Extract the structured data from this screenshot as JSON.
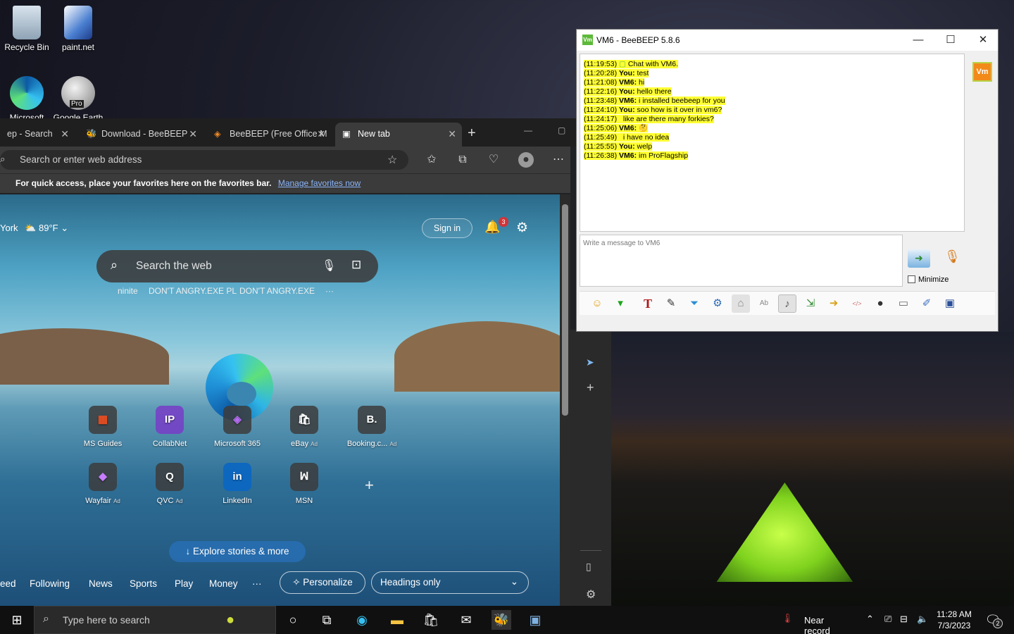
{
  "desktop": {
    "icons": [
      {
        "label": "Recycle Bin"
      },
      {
        "label": "paint.net"
      },
      {
        "label": "Microsoft Edge"
      },
      {
        "label": "Google Earth Pro"
      }
    ],
    "earth_badge": "Pro"
  },
  "edge": {
    "tabs": [
      {
        "label": "ep - Search"
      },
      {
        "label": "Download - BeeBEEP"
      },
      {
        "label": "BeeBEEP (Free Office M"
      },
      {
        "label": "New tab"
      }
    ],
    "address_placeholder": "Search or enter web address",
    "favbar": {
      "text": "For quick access, place your favorites here on the favorites bar.",
      "link": "Manage favorites now"
    },
    "newtab": {
      "location": "York",
      "temp": "89°F",
      "signin": "Sign in",
      "notif_count": "3",
      "search_placeholder": "Search the web",
      "trending": [
        "ninite",
        "DON'T ANGRY.EXE PL",
        "DON'T ANGRY.EXE",
        "···"
      ],
      "quick_links": [
        {
          "label": "MS Guides",
          "ad": "",
          "glyph": "▦"
        },
        {
          "label": "CollabNet",
          "ad": "",
          "glyph": "IP"
        },
        {
          "label": "Microsoft 365",
          "ad": "",
          "glyph": "◈"
        },
        {
          "label": "eBay",
          "ad": "Ad",
          "glyph": "🛍"
        },
        {
          "label": "Booking.c...",
          "ad": "Ad",
          "glyph": "B."
        },
        {
          "label": "Wayfair",
          "ad": "Ad",
          "glyph": "◆"
        },
        {
          "label": "QVC",
          "ad": "Ad",
          "glyph": "Q"
        },
        {
          "label": "LinkedIn",
          "ad": "",
          "glyph": "in"
        },
        {
          "label": "MSN",
          "ad": "",
          "glyph": "ꟽ"
        }
      ],
      "add_link": "+",
      "explore": "Explore stories & more",
      "feed_tabs": [
        "eed",
        "Following",
        "News",
        "Sports",
        "Play",
        "Money",
        "···"
      ],
      "personalize": "Personalize",
      "headings_select": "Headings only"
    }
  },
  "beebeep": {
    "title": "VM6 - BeeBEEP 5.8.6",
    "title_icon": "Vm",
    "avatar": "Vm",
    "messages": [
      {
        "time": "(11:19:53)",
        "who": "",
        "text": "Chat with VM6."
      },
      {
        "time": "(11:20:28)",
        "who": "You:",
        "text": "test"
      },
      {
        "time": "(11:21:08)",
        "who": "VM6:",
        "text": "hi"
      },
      {
        "time": "(11:22:16)",
        "who": "You:",
        "text": "hello there"
      },
      {
        "time": "(11:23:48)",
        "who": "VM6:",
        "text": "i installed beebeep for you"
      },
      {
        "time": "(11:24:10)",
        "who": "You:",
        "text": "soo how is it over in vm6?"
      },
      {
        "time": "(11:24:17)",
        "who": "",
        "text": "like are there many forkies?"
      },
      {
        "time": "(11:25:06)",
        "who": "VM6:",
        "text": "🤔"
      },
      {
        "time": "(11:25:49)",
        "who": "",
        "text": "i have no idea"
      },
      {
        "time": "(11:25:55)",
        "who": "You:",
        "text": "welp"
      },
      {
        "time": "(11:26:38)",
        "who": "VM6:",
        "text": "im ProFlagship"
      }
    ],
    "input_placeholder": "Write a message to VM6",
    "minimize_label": "Minimize",
    "toolbar": [
      {
        "name": "emoticon-icon",
        "glyph": "☺"
      },
      {
        "name": "green-tool-icon",
        "glyph": "▾"
      },
      {
        "name": "font-icon",
        "glyph": "T"
      },
      {
        "name": "color-icon",
        "glyph": "✎"
      },
      {
        "name": "filter-icon",
        "glyph": "⏷"
      },
      {
        "name": "settings-icon",
        "glyph": "⚙"
      },
      {
        "name": "bell-icon",
        "glyph": "⌂"
      },
      {
        "name": "spellcheck-icon",
        "glyph": "Ab"
      },
      {
        "name": "sound-icon",
        "glyph": "♪"
      },
      {
        "name": "save-chat-icon",
        "glyph": "⇲"
      },
      {
        "name": "send-file-icon",
        "glyph": "➜"
      },
      {
        "name": "code-icon",
        "glyph": "</>"
      },
      {
        "name": "screenshot-icon",
        "glyph": "●"
      },
      {
        "name": "window-icon",
        "glyph": "▭"
      },
      {
        "name": "note-icon",
        "glyph": "✐"
      },
      {
        "name": "share-icon",
        "glyph": "▣"
      }
    ]
  },
  "taskbar": {
    "search_placeholder": "Type here to search",
    "weather_text": "Near record",
    "time": "11:28 AM",
    "date": "7/3/2023",
    "notif_count": "2"
  }
}
